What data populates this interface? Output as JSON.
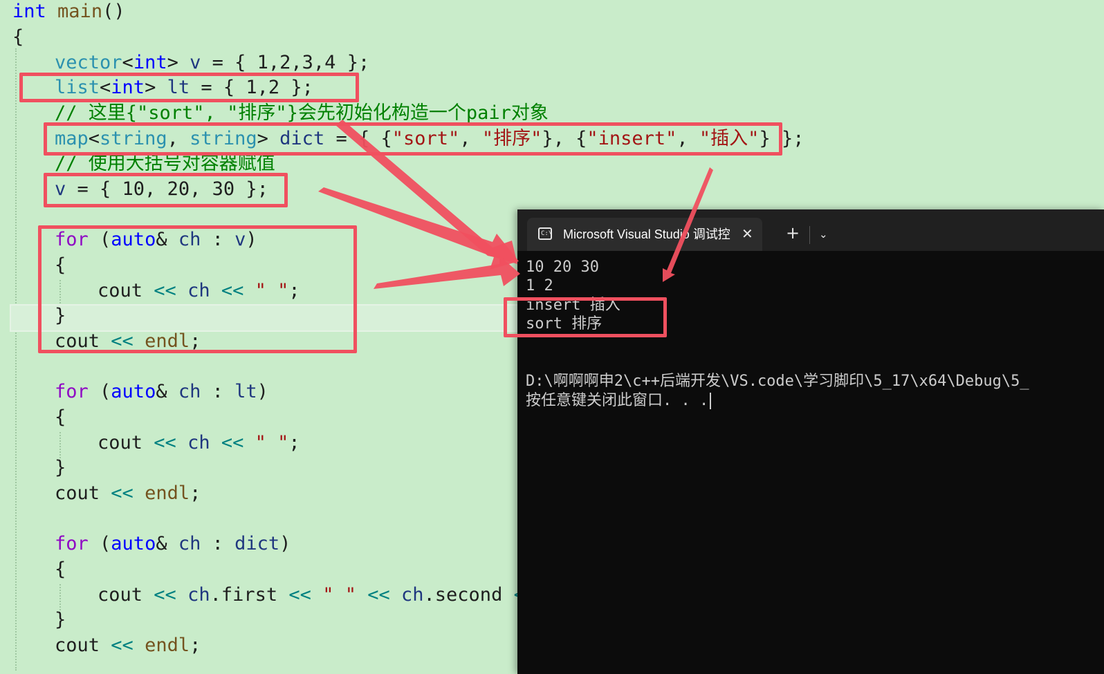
{
  "code": {
    "line1": {
      "a": "int",
      "b": " ",
      "c": "main",
      "d": "()"
    },
    "line2": "{",
    "line3": {
      "a": "vector",
      "b": "<",
      "c": "int",
      "d": "> ",
      "e": "v",
      "f": " = { 1,2,3,4 };"
    },
    "line4": {
      "a": "list",
      "b": "<",
      "c": "int",
      "d": "> ",
      "e": "lt",
      "f": " = { 1,2 };"
    },
    "line5": "// 这里{\"sort\", \"排序\"}会先初始化构造一个pair对象",
    "line6": {
      "a": "map",
      "b": "<",
      "c": "string",
      "d": ", ",
      "e": "string",
      "f": "> ",
      "g": "dict",
      "h": " = { {",
      "i": "\"sort\"",
      "j": ", ",
      "k": "\"排序\"",
      "l": "}, {",
      "m": "\"insert\"",
      "n": ", ",
      "o": "\"插入\"",
      "p": "} };"
    },
    "line7": "// 使用大括号对容器赋值",
    "line8": {
      "a": "v",
      "b": " = { 10, 20, 30 };"
    },
    "loop1": {
      "for": "for",
      "open": " (",
      "auto": "auto",
      "amp": "& ",
      "ch": "ch",
      "colon": " : ",
      "var": "v",
      "close": ")",
      "brace_open": "{",
      "cout": "cout",
      "sp1": " ",
      "op1": "<<",
      "sp2": " ",
      "ch2": "ch",
      "sp3": " ",
      "op2": "<<",
      "sp4": " ",
      "str": "\" \"",
      "semi": ";",
      "brace_close": "}",
      "cout2": "cout",
      "op3": " << ",
      "endl": "endl",
      "semi2": ";"
    },
    "loop2": {
      "for": "for",
      "open": " (",
      "auto": "auto",
      "amp": "& ",
      "ch": "ch",
      "colon": " : ",
      "var": "lt",
      "close": ")",
      "brace_open": "{",
      "cout": "cout",
      "sp1": " ",
      "op1": "<<",
      "sp2": " ",
      "ch2": "ch",
      "sp3": " ",
      "op2": "<<",
      "sp4": " ",
      "str": "\" \"",
      "semi": ";",
      "brace_close": "}",
      "cout2": "cout",
      "op3": " << ",
      "endl": "endl",
      "semi2": ";"
    },
    "loop3": {
      "for": "for",
      "open": " (",
      "auto": "auto",
      "amp": "& ",
      "ch": "ch",
      "colon": " : ",
      "var": "dict",
      "close": ")",
      "brace_open": "{",
      "cout": "cout",
      "sp1": " ",
      "op1": "<<",
      "sp2": " ",
      "chf": "ch",
      "first": ".first",
      "sp3": " ",
      "op2": "<<",
      "sp4": " ",
      "str": "\" \"",
      "sp5": " ",
      "op4": "<<",
      "sp6": " ",
      "chs": "ch",
      "second": ".second",
      "sp7": " ",
      "op5": "<<",
      "brace_close": "}",
      "cout2": "cout",
      "op3": " << ",
      "endl": "endl",
      "semi2": ";"
    }
  },
  "terminal": {
    "tab_title": "Microsoft Visual Studio 调试控",
    "icon_text": "C:\\",
    "close_glyph": "✕",
    "new_tab_glyph": "+",
    "dropdown_glyph": "⌄",
    "output": [
      "10 20 30",
      "1 2",
      "insert 插入",
      "sort 排序"
    ],
    "path_line": "D:\\啊啊啊申2\\c++后端开发\\VS.code\\学习脚印\\5_17\\x64\\Debug\\5_",
    "prompt_line": "按任意键关闭此窗口. . ."
  },
  "colors": {
    "annotation": "#f0505f",
    "editor_bg": "#c9ecca",
    "terminal_bg": "#0c0c0c"
  }
}
